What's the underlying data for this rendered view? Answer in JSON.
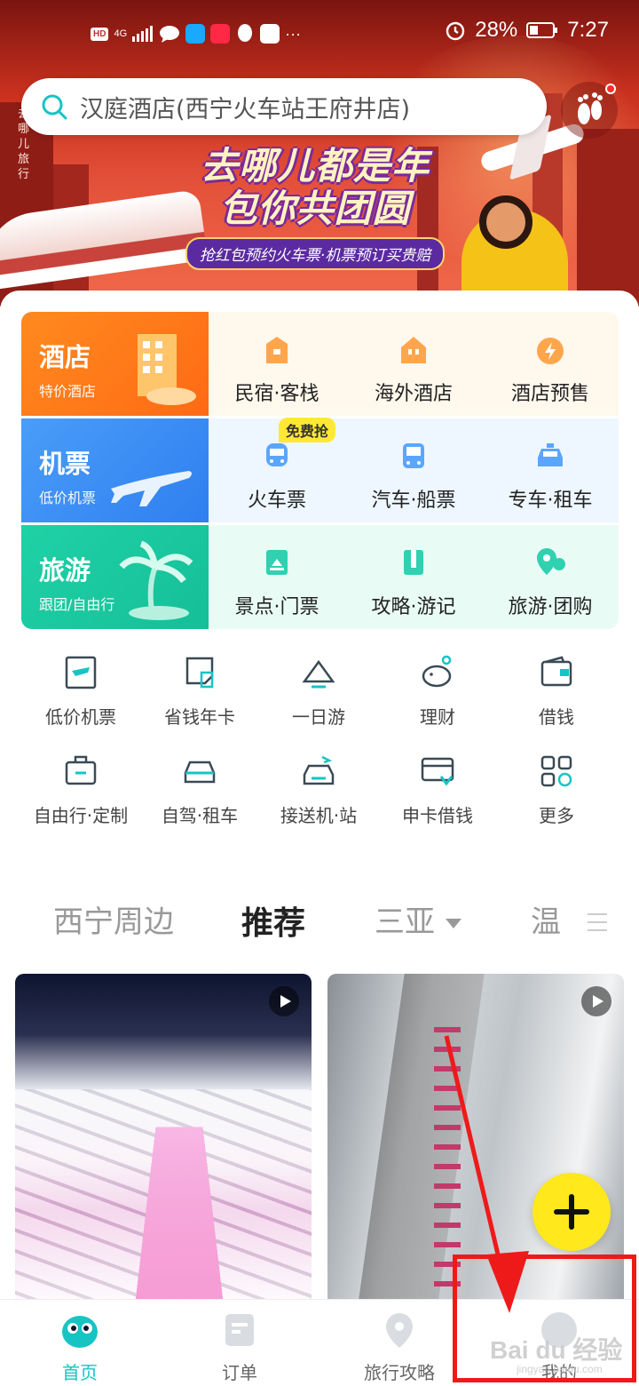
{
  "status_bar": {
    "hd": "HD",
    "signal": "4G",
    "battery": "28%",
    "time": "7:27"
  },
  "search": {
    "placeholder": "汉庭酒店(西宁火车站王府井店)"
  },
  "banner": {
    "vertical_text": "去哪儿旅行",
    "line1": "去哪儿都是年",
    "line2": "包你共团圆",
    "sub": "抢红包预约火车票·机票预订买贵赔"
  },
  "main_grid": {
    "rows": [
      {
        "title": "酒店",
        "subtitle": "特价酒店",
        "color": "#ff7a1e",
        "items": [
          {
            "label": "民宿·客栈",
            "icon": "house-icon",
            "color": "#ff9e3d"
          },
          {
            "label": "海外酒店",
            "icon": "overseas-hotel-icon",
            "color": "#ff9e3d"
          },
          {
            "label": "酒店预售",
            "icon": "flash-sale-icon",
            "color": "#ff9e3d"
          }
        ]
      },
      {
        "title": "机票",
        "subtitle": "低价机票",
        "color": "#3c8ef5",
        "items": [
          {
            "label": "火车票",
            "icon": "train-icon",
            "color": "#4a9df8"
          },
          {
            "label": "汽车·船票",
            "icon": "bus-icon",
            "color": "#4a9df8"
          },
          {
            "label": "专车·租车",
            "icon": "taxi-icon",
            "color": "#4a9df8"
          }
        ]
      },
      {
        "title": "旅游",
        "subtitle": "跟团/自由行",
        "color": "#1ecfa8",
        "items": [
          {
            "label": "景点·门票",
            "icon": "ticket-icon",
            "color": "#24c9a8"
          },
          {
            "label": "攻略·游记",
            "icon": "guide-book-icon",
            "color": "#24c9a8"
          },
          {
            "label": "旅游·团购",
            "icon": "map-pin-icon",
            "color": "#24c9a8"
          }
        ]
      }
    ],
    "badge": "免费抢"
  },
  "quick_links": [
    {
      "label": "低价机票",
      "icon": "plane-ticket-icon"
    },
    {
      "label": "省钱年卡",
      "icon": "card-icon"
    },
    {
      "label": "一日游",
      "icon": "mountain-icon"
    },
    {
      "label": "理财",
      "icon": "piggy-bank-icon"
    },
    {
      "label": "借钱",
      "icon": "wallet-icon"
    },
    {
      "label": "自由行·定制",
      "icon": "suitcase-icon"
    },
    {
      "label": "自驾·租车",
      "icon": "car-icon"
    },
    {
      "label": "接送机·站",
      "icon": "shuttle-icon"
    },
    {
      "label": "申卡借钱",
      "icon": "credit-card-icon"
    },
    {
      "label": "更多",
      "icon": "grid-icon"
    }
  ],
  "tabs": [
    {
      "label": "西宁周边"
    },
    {
      "label": "推荐"
    },
    {
      "label": "三亚"
    },
    {
      "label": "温"
    }
  ],
  "bottom_nav": [
    {
      "label": "首页",
      "icon": "home-mascot-icon"
    },
    {
      "label": "订单",
      "icon": "order-icon"
    },
    {
      "label": "旅行攻略",
      "icon": "location-icon"
    },
    {
      "label": "我的",
      "icon": "profile-icon"
    }
  ],
  "watermark": {
    "main": "Bai du 经验",
    "sub": "jingyan.baidu.com"
  },
  "colors": {
    "accent": "#17c4c4",
    "highlight": "#ffe834",
    "annotation": "#ee1a1a"
  }
}
